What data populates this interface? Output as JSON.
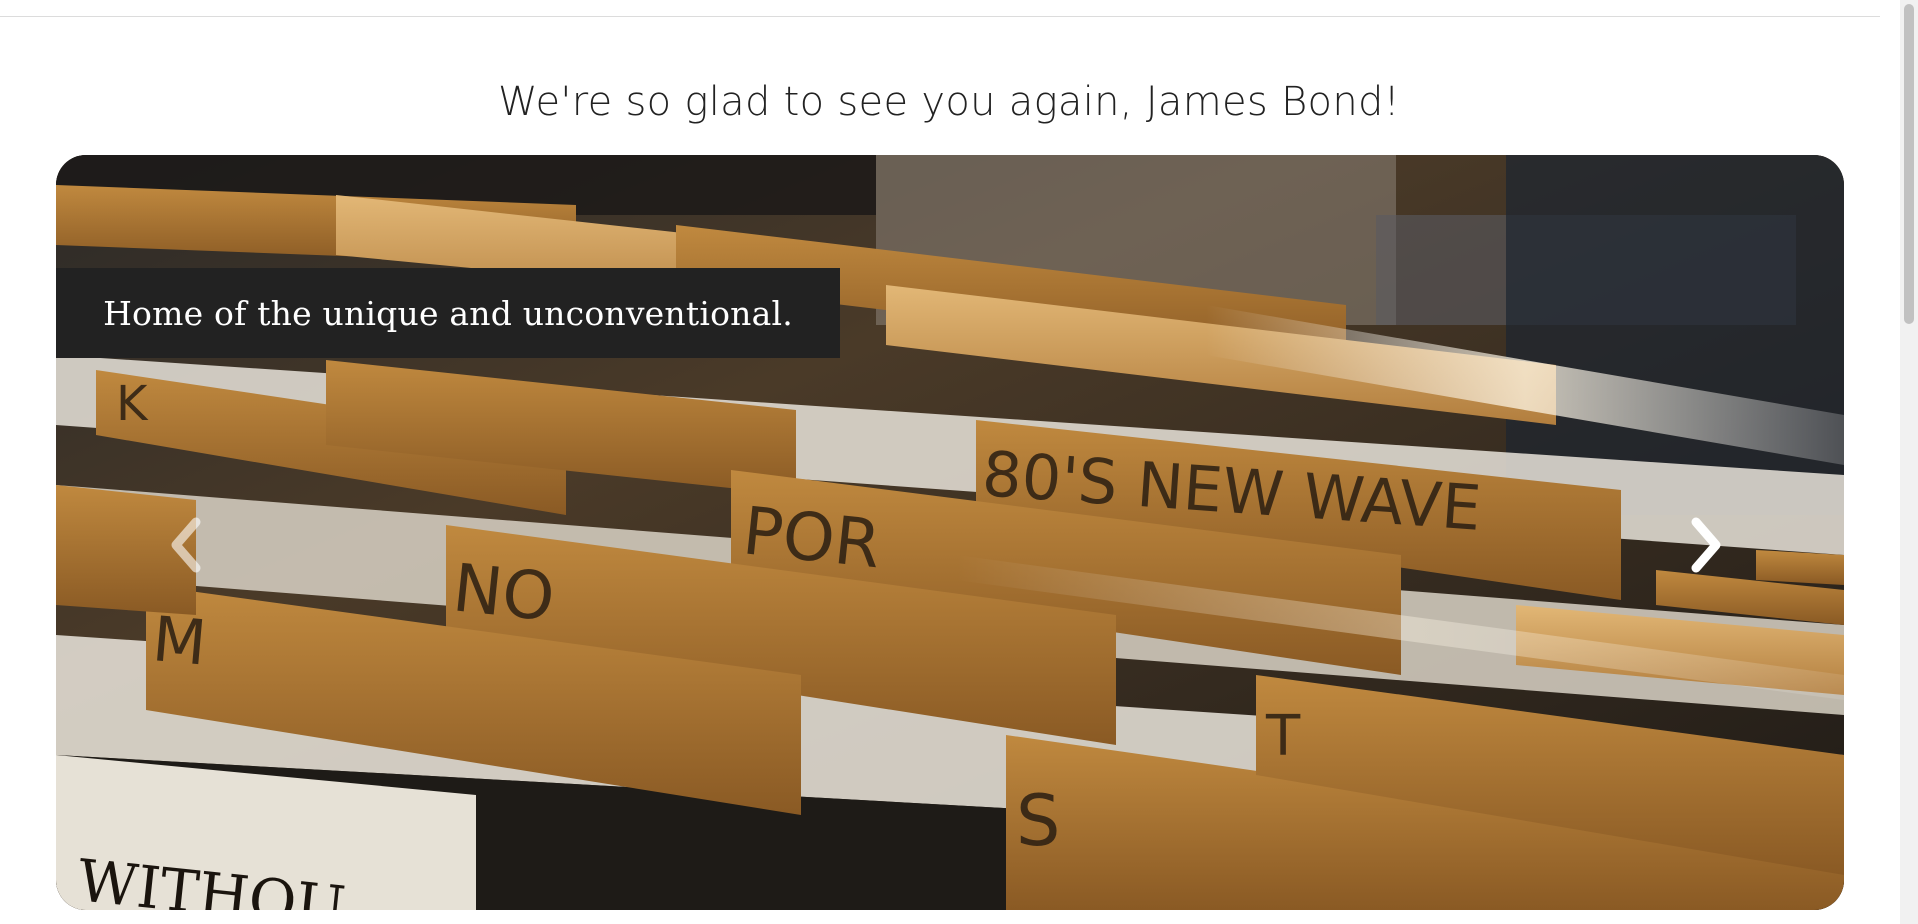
{
  "greeting": "We're so glad to see you again, James Bond!",
  "carousel": {
    "caption": "Home of the unique and unconventional.",
    "divider_labels": [
      "K",
      "80'S NEW WAVE",
      "POR",
      "NO",
      "M",
      "S",
      "T",
      "WITHOU"
    ],
    "prev_icon": "chevron-left-icon",
    "next_icon": "chevron-right-icon"
  },
  "colors": {
    "caption_bg": "#222222",
    "caption_text": "#ffffff",
    "greeting_text": "#222222"
  }
}
